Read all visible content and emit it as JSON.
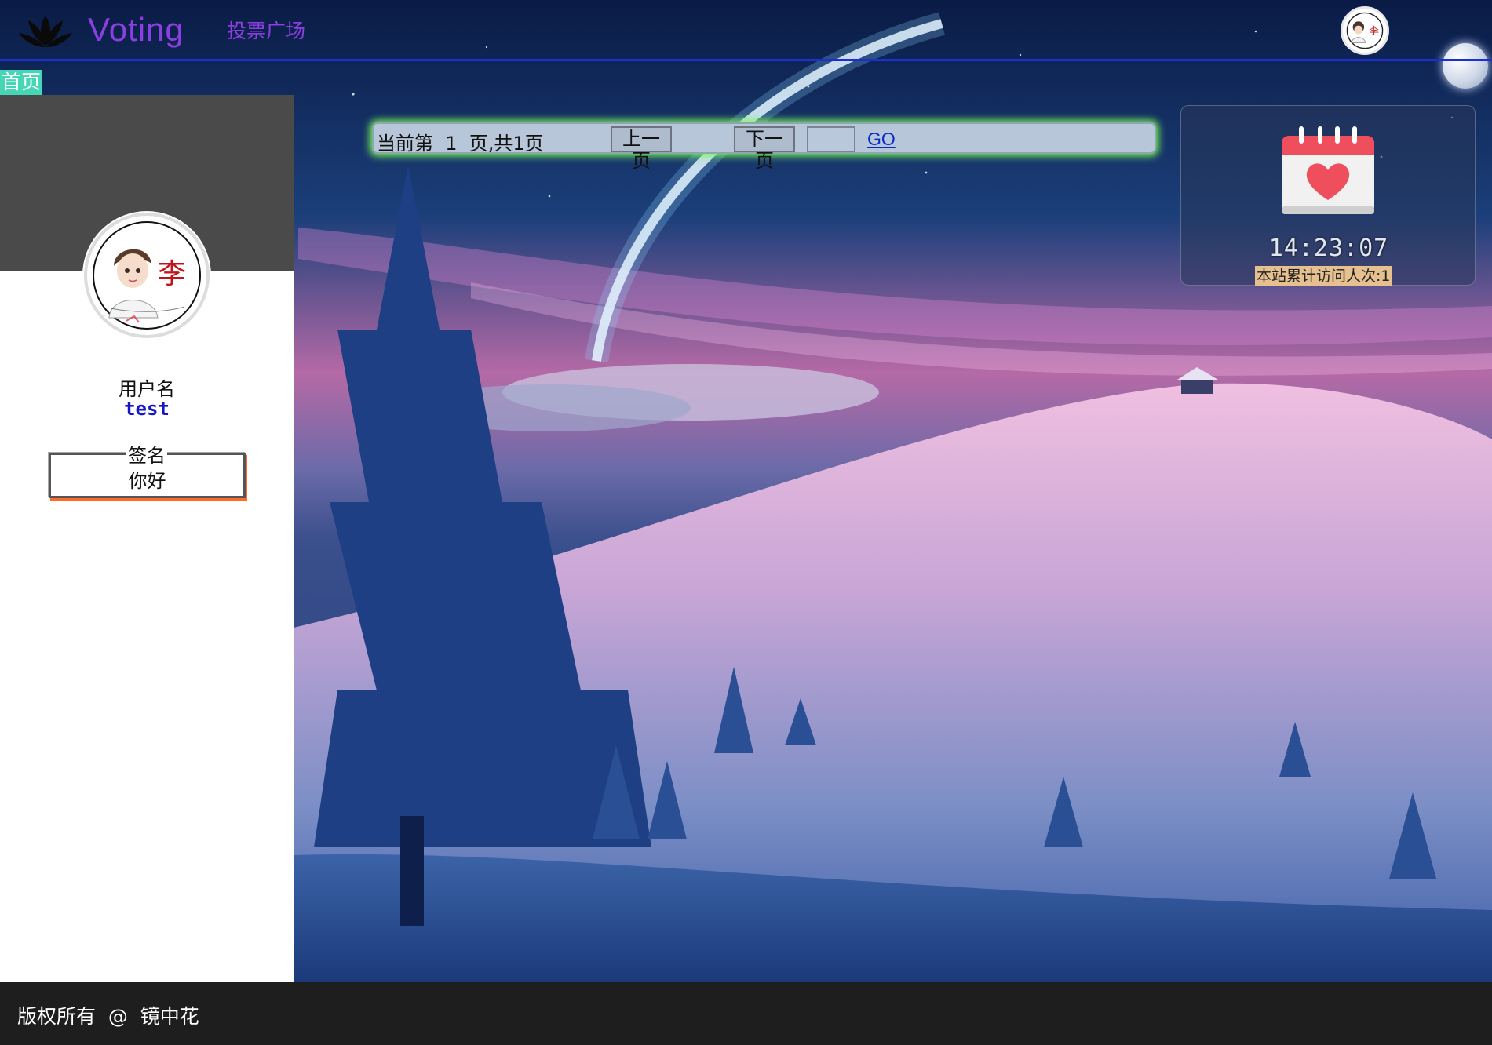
{
  "header": {
    "brand": "Voting",
    "nav_vote": "投票广场",
    "avatar_glyph": "李"
  },
  "breadcrumb": {
    "home": "首页"
  },
  "profile": {
    "avatar_glyph": "李",
    "username_label": "用户名",
    "username": "test",
    "signature_label": "签名",
    "signature": "你好"
  },
  "pager": {
    "info": "当前第  1  页,共1页",
    "prev_label": "上一页",
    "next_label": "下一页",
    "page_input_value": "",
    "go_label": "GO"
  },
  "widget": {
    "time": "14:23:07",
    "visits": "本站累计访问人次:1"
  },
  "footer": {
    "copyright": "版权所有  @  镜中花"
  },
  "colors": {
    "brand": "#8b3fe0",
    "header_rule": "#1a2fd6",
    "home_bg": "#44d6b5",
    "footer_bg": "#1e1e1e",
    "link": "#0b29c9"
  }
}
